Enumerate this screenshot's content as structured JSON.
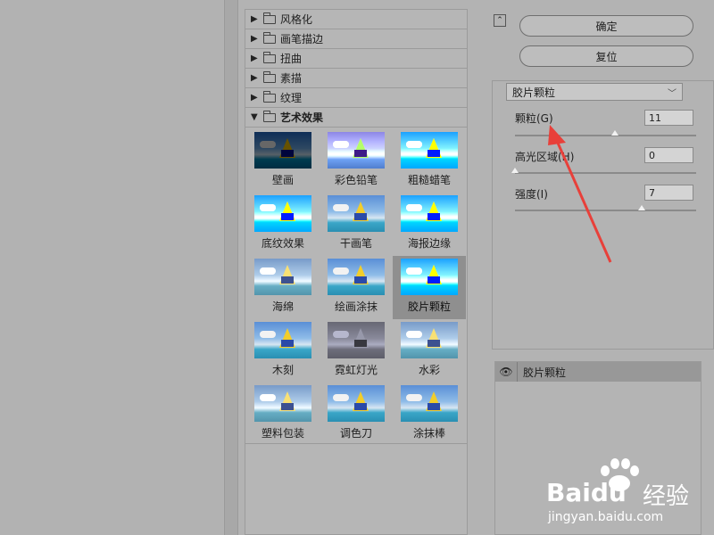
{
  "filter_categories": [
    {
      "label": "风格化",
      "expanded": false
    },
    {
      "label": "画笔描边",
      "expanded": false
    },
    {
      "label": "扭曲",
      "expanded": false
    },
    {
      "label": "素描",
      "expanded": false
    },
    {
      "label": "纹理",
      "expanded": false
    },
    {
      "label": "艺术效果",
      "expanded": true
    }
  ],
  "artistic_filters": [
    {
      "label": "壁画",
      "selected": false
    },
    {
      "label": "彩色铅笔",
      "selected": false
    },
    {
      "label": "粗糙蜡笔",
      "selected": false
    },
    {
      "label": "底纹效果",
      "selected": false
    },
    {
      "label": "干画笔",
      "selected": false
    },
    {
      "label": "海报边缘",
      "selected": false
    },
    {
      "label": "海绵",
      "selected": false
    },
    {
      "label": "绘画涂抹",
      "selected": false
    },
    {
      "label": "胶片颗粒",
      "selected": true
    },
    {
      "label": "木刻",
      "selected": false
    },
    {
      "label": "霓虹灯光",
      "selected": false
    },
    {
      "label": "水彩",
      "selected": false
    },
    {
      "label": "塑料包装",
      "selected": false
    },
    {
      "label": "调色刀",
      "selected": false
    },
    {
      "label": "涂抹棒",
      "selected": false
    }
  ],
  "buttons": {
    "ok": "确定",
    "reset": "复位"
  },
  "filter_select": {
    "value": "胶片颗粒"
  },
  "params": {
    "grain": {
      "label": "颗粒(G)",
      "value": "11",
      "max": 20
    },
    "highlight": {
      "label": "高光区域(H)",
      "value": "0",
      "max": 20
    },
    "intensity": {
      "label": "强度(I)",
      "value": "7",
      "max": 10
    }
  },
  "layers": [
    {
      "name": "胶片颗粒",
      "visible": true
    }
  ],
  "icons": {
    "collapse": "collapse-icon",
    "eye": "eye-icon",
    "folder": "folder-icon"
  },
  "watermark": {
    "brand": "Baidu",
    "brand_cn": "经验",
    "url": "jingyan.baidu.com"
  },
  "colors": {
    "annotation_arrow": "#e8403a",
    "selected_thumb_bg": "#8f8f8f"
  }
}
